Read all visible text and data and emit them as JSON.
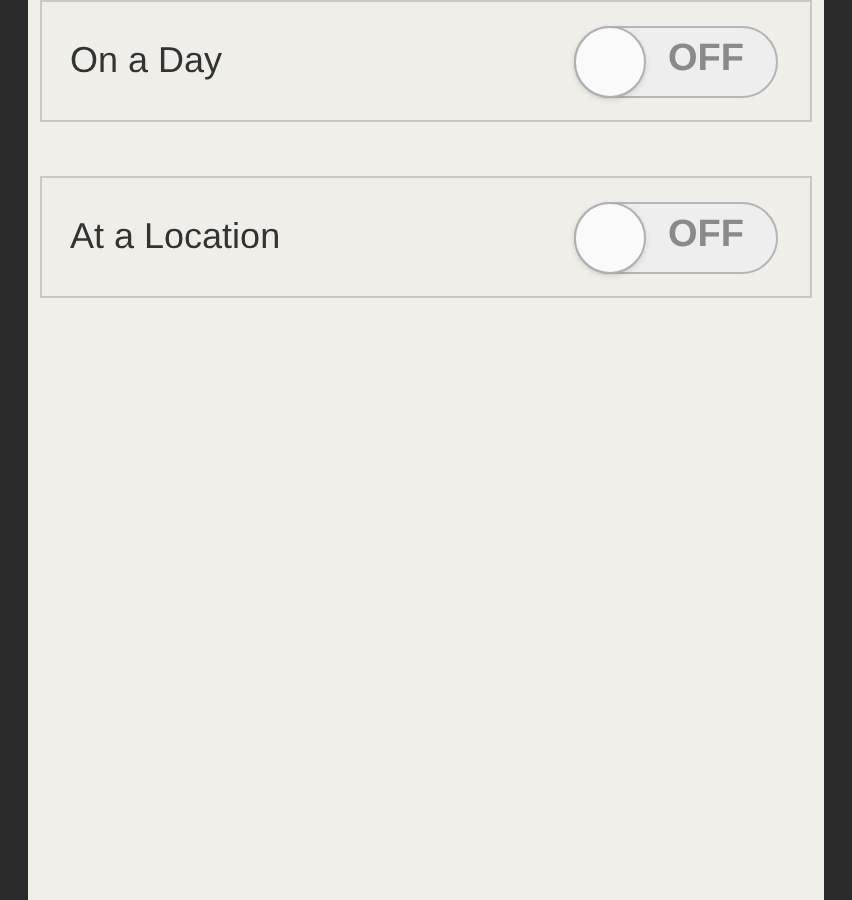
{
  "rows": [
    {
      "label": "On a Day",
      "on": false,
      "toggle_text": "OFF"
    },
    {
      "label": "At a Location",
      "on": false,
      "toggle_text": "OFF"
    }
  ]
}
